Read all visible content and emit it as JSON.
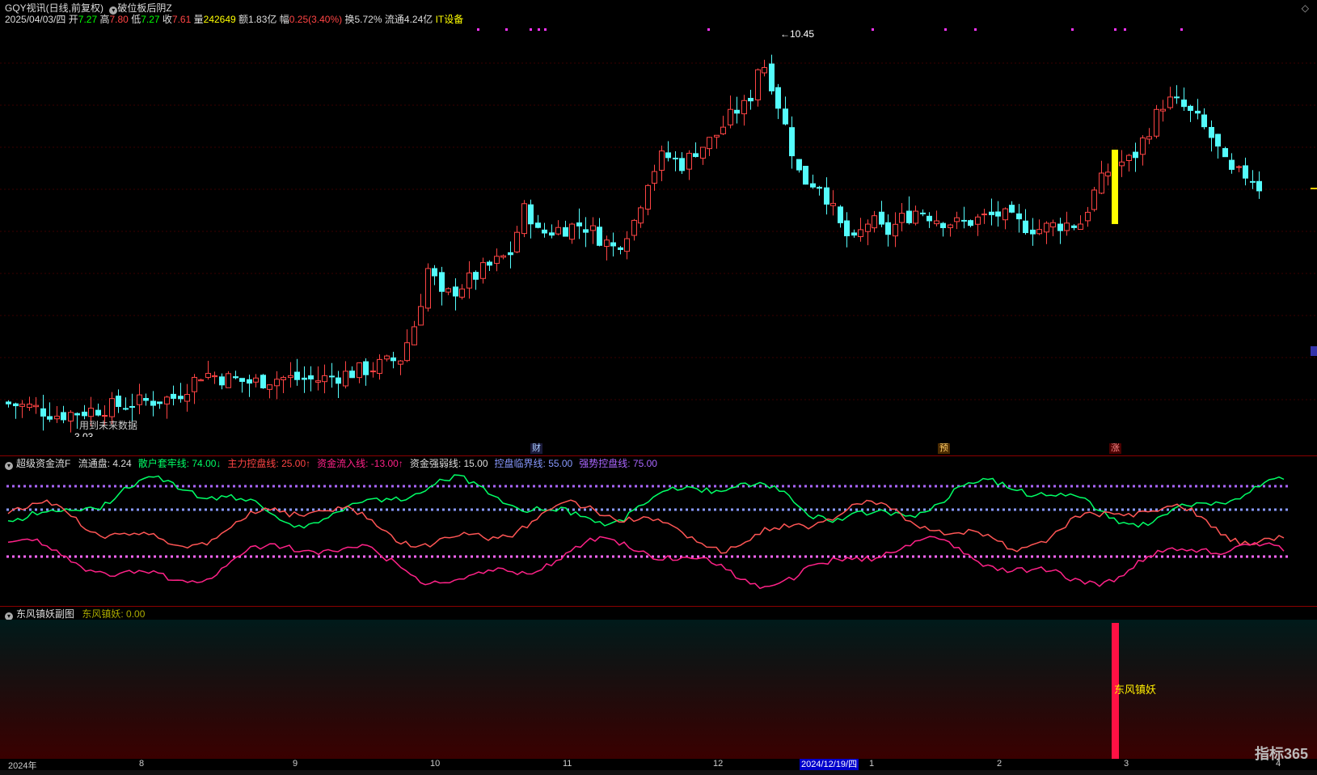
{
  "header": {
    "stock_title": "GQY视讯(日线,前复权)",
    "strategy": "破位板后阴Z",
    "date": "2025/04/03/四",
    "open_label": "开",
    "open": "7.27",
    "high_label": "高",
    "high": "7.80",
    "low_label": "低",
    "low": "7.27",
    "close_label": "收",
    "close": "7.61",
    "vol_label": "量",
    "vol": "242649",
    "amt_label": "额",
    "amt": "1.83亿",
    "chg_label": "幅",
    "chg": "0.25(3.40%)",
    "turn_label": "换",
    "turn": "5.72%",
    "float_label": "流通",
    "float": "4.24亿",
    "sector": "IT设备"
  },
  "main_chart": {
    "max_label": "10.45",
    "min_label": "3.03",
    "future_note": "用到未来数据",
    "markers": {
      "cai": "财",
      "yu": "预",
      "zhang": "涨"
    }
  },
  "indicator1": {
    "name": "超级资金流F",
    "items": [
      {
        "label": "流通盘: 4.24",
        "color": "#dddddd"
      },
      {
        "label": "散户套牢线: 74.00↓",
        "color": "#00ff66"
      },
      {
        "label": "主力控盘线: 25.00↑",
        "color": "#ff4444"
      },
      {
        "label": "资金流入线: -13.00↑",
        "color": "#ff2288"
      },
      {
        "label": "资金强弱线: 15.00",
        "color": "#dddddd"
      },
      {
        "label": "控盘临界线: 55.00",
        "color": "#8899ff"
      },
      {
        "label": "强势控盘线: 75.00",
        "color": "#aa66ff"
      }
    ]
  },
  "indicator2": {
    "name": "东风镇妖副图",
    "value_label": "东风镇妖: 0.00",
    "bar_label": "东风镇妖"
  },
  "x_axis": [
    {
      "label": "2024年",
      "month": 0
    },
    {
      "label": "8",
      "month": 1
    },
    {
      "label": "9",
      "month": 2
    },
    {
      "label": "10",
      "month": 3
    },
    {
      "label": "11",
      "month": 4
    },
    {
      "label": "12",
      "month": 5
    },
    {
      "label": "1",
      "month": 6
    },
    {
      "label": "2",
      "month": 7
    },
    {
      "label": "3",
      "month": 8
    },
    {
      "label": "4",
      "month": 9
    }
  ],
  "cursor_date": "2024/12/19/四",
  "watermark": "指标365",
  "colors": {
    "up": "#ff4444",
    "down": "#54fcfc",
    "grid": "#550000",
    "signal": "#ffff00",
    "green_line": "#00ff66",
    "red_line": "#ff5555",
    "pink_line": "#ff2288"
  }
}
